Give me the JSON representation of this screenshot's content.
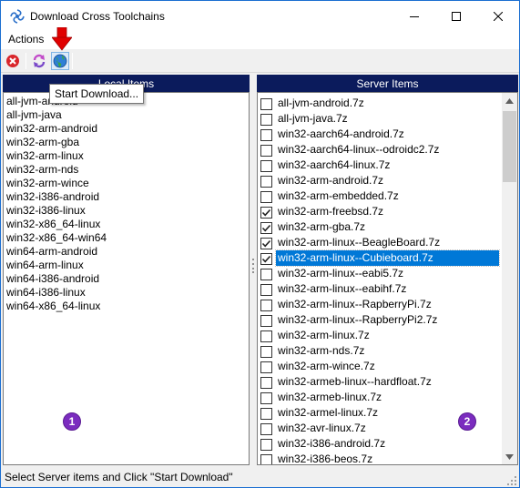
{
  "window": {
    "title": "Download Cross Toolchains"
  },
  "menu": {
    "actions": "Actions"
  },
  "toolbar": {
    "tooltip": "Start Download..."
  },
  "local": {
    "header": "Local Items",
    "items": [
      "all-jvm-android",
      "all-jvm-java",
      "win32-arm-android",
      "win32-arm-gba",
      "win32-arm-linux",
      "win32-arm-nds",
      "win32-arm-wince",
      "win32-i386-android",
      "win32-i386-linux",
      "win32-x86_64-linux",
      "win32-x86_64-win64",
      "win64-arm-android",
      "win64-arm-linux",
      "win64-i386-android",
      "win64-i386-linux",
      "win64-x86_64-linux"
    ],
    "badge": "1"
  },
  "server": {
    "header": "Server Items",
    "items": [
      {
        "label": "all-jvm-android.7z",
        "checked": false
      },
      {
        "label": "all-jvm-java.7z",
        "checked": false
      },
      {
        "label": "win32-aarch64-android.7z",
        "checked": false
      },
      {
        "label": "win32-aarch64-linux--odroidc2.7z",
        "checked": false
      },
      {
        "label": "win32-aarch64-linux.7z",
        "checked": false
      },
      {
        "label": "win32-arm-android.7z",
        "checked": false
      },
      {
        "label": "win32-arm-embedded.7z",
        "checked": false
      },
      {
        "label": "win32-arm-freebsd.7z",
        "checked": true
      },
      {
        "label": "win32-arm-gba.7z",
        "checked": true
      },
      {
        "label": "win32-arm-linux--BeagleBoard.7z",
        "checked": true
      },
      {
        "label": "win32-arm-linux--Cubieboard.7z",
        "checked": true,
        "selected": true
      },
      {
        "label": "win32-arm-linux--eabi5.7z",
        "checked": false
      },
      {
        "label": "win32-arm-linux--eabihf.7z",
        "checked": false
      },
      {
        "label": "win32-arm-linux--RapberryPi.7z",
        "checked": false
      },
      {
        "label": "win32-arm-linux--RapberryPi2.7z",
        "checked": false
      },
      {
        "label": "win32-arm-linux.7z",
        "checked": false
      },
      {
        "label": "win32-arm-nds.7z",
        "checked": false
      },
      {
        "label": "win32-arm-wince.7z",
        "checked": false
      },
      {
        "label": "win32-armeb-linux--hardfloat.7z",
        "checked": false
      },
      {
        "label": "win32-armeb-linux.7z",
        "checked": false
      },
      {
        "label": "win32-armel-linux.7z",
        "checked": false
      },
      {
        "label": "win32-avr-linux.7z",
        "checked": false
      },
      {
        "label": "win32-i386-android.7z",
        "checked": false
      },
      {
        "label": "win32-i386-beos.7z",
        "checked": false
      }
    ],
    "badge": "2"
  },
  "status": {
    "text": "Select Server items and Click \"Start Download\""
  },
  "colors": {
    "header_bg": "#0b1b5c",
    "selection": "#0078d7",
    "badge": "#7b2cbf",
    "arrow": "#e00000"
  },
  "icons": [
    "app-icon",
    "minimize-icon",
    "maximize-icon",
    "close-icon",
    "stop-icon",
    "refresh-icon",
    "download-globe-icon",
    "arrow-down-icon"
  ]
}
